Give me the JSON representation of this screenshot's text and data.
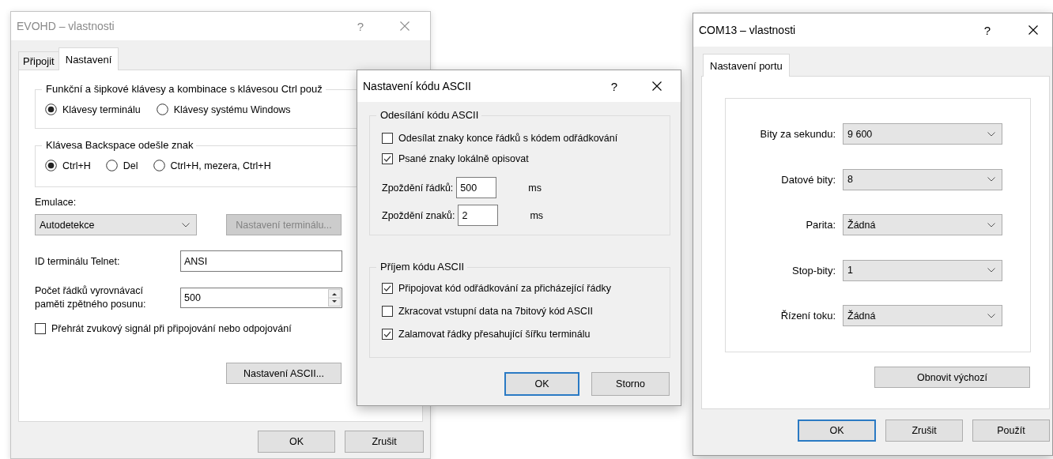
{
  "terminal_dialog": {
    "title": "EVOHD – vlastnosti",
    "help": "?",
    "active": false,
    "tabs": [
      {
        "label": "Připojit",
        "selected": false
      },
      {
        "label": "Nastavení",
        "selected": true
      }
    ],
    "key_groups": [
      {
        "title": "Funkční a šipkové klávesy a kombinace s klávesou Ctrl použ",
        "options": [
          {
            "label": "Klávesy terminálu",
            "selected": true
          },
          {
            "label": "Klávesy systému Windows",
            "selected": false
          }
        ]
      },
      {
        "title": "Klávesa Backspace odešle znak",
        "options": [
          {
            "label": "Ctrl+H",
            "selected": true
          },
          {
            "label": "Del",
            "selected": false
          },
          {
            "label": "Ctrl+H, mezera, Ctrl+H",
            "selected": false
          }
        ]
      }
    ],
    "emulation": {
      "label": "Emulace:",
      "value": "Autodetekce"
    },
    "terminal_settings_button": {
      "label": "Nastavení terminálu...",
      "disabled": true
    },
    "telnet_id": {
      "label": "ID terminálu Telnet:",
      "value": "ANSI"
    },
    "scrollback_lines": {
      "label": "Počet řádků vyrovnávací paměti zpětného posunu:",
      "value": "500"
    },
    "sound_signal": {
      "label": "Přehrát zvukový signál při připojování nebo odpojování",
      "checked": false
    },
    "ascii_button": {
      "label": "Nastavení ASCII...",
      "disabled": false
    },
    "buttons": [
      {
        "label": "OK",
        "default": false
      },
      {
        "label": "Zrušit",
        "default": false
      }
    ]
  },
  "ascii_dialog": {
    "title": "Nastavení kódu ASCII",
    "help": "?",
    "active": true,
    "groups": [
      {
        "title": "Odesílání kódu ASCII",
        "items": [
          {
            "kind": "checkbox",
            "label": "Odesílat znaky konce řádků s kódem odřádkování",
            "checked": false
          },
          {
            "kind": "checkbox",
            "label": "Psané znaky lokálně opisovat",
            "checked": true
          },
          {
            "kind": "number",
            "label": "Zpoždění řádků:",
            "value": "500",
            "unit": "ms"
          },
          {
            "kind": "number",
            "label": "Zpoždění znaků:",
            "value": "2",
            "unit": "ms"
          }
        ]
      },
      {
        "title": "Příjem kódu ASCII",
        "items": [
          {
            "kind": "checkbox",
            "label": "Připojovat kód odřádkování za přicházející řádky",
            "checked": true
          },
          {
            "kind": "checkbox",
            "label": "Zkracovat vstupní data na 7bitový kód ASCII",
            "checked": false
          },
          {
            "kind": "checkbox",
            "label": "Zalamovat řádky přesahující šířku terminálu",
            "checked": true
          }
        ]
      }
    ],
    "buttons": [
      {
        "label": "OK",
        "default": true
      },
      {
        "label": "Storno",
        "default": false
      }
    ]
  },
  "port_dialog": {
    "title": "COM13 – vlastnosti",
    "help": "?",
    "active": true,
    "tabs": [
      {
        "label": "Nastavení portu",
        "selected": true
      }
    ],
    "fields": [
      {
        "label": "Bity za sekundu:",
        "value": "9 600"
      },
      {
        "label": "Datové bity:",
        "value": "8"
      },
      {
        "label": "Parita:",
        "value": "Žádná"
      },
      {
        "label": "Stop-bity:",
        "value": "1"
      },
      {
        "label": "Řízení toku:",
        "value": "Žádná"
      }
    ],
    "restore_button": {
      "label": "Obnovit výchozí"
    },
    "buttons": [
      {
        "label": "OK",
        "default": true
      },
      {
        "label": "Zrušit",
        "default": false
      },
      {
        "label": "Použít",
        "default": false
      }
    ]
  }
}
